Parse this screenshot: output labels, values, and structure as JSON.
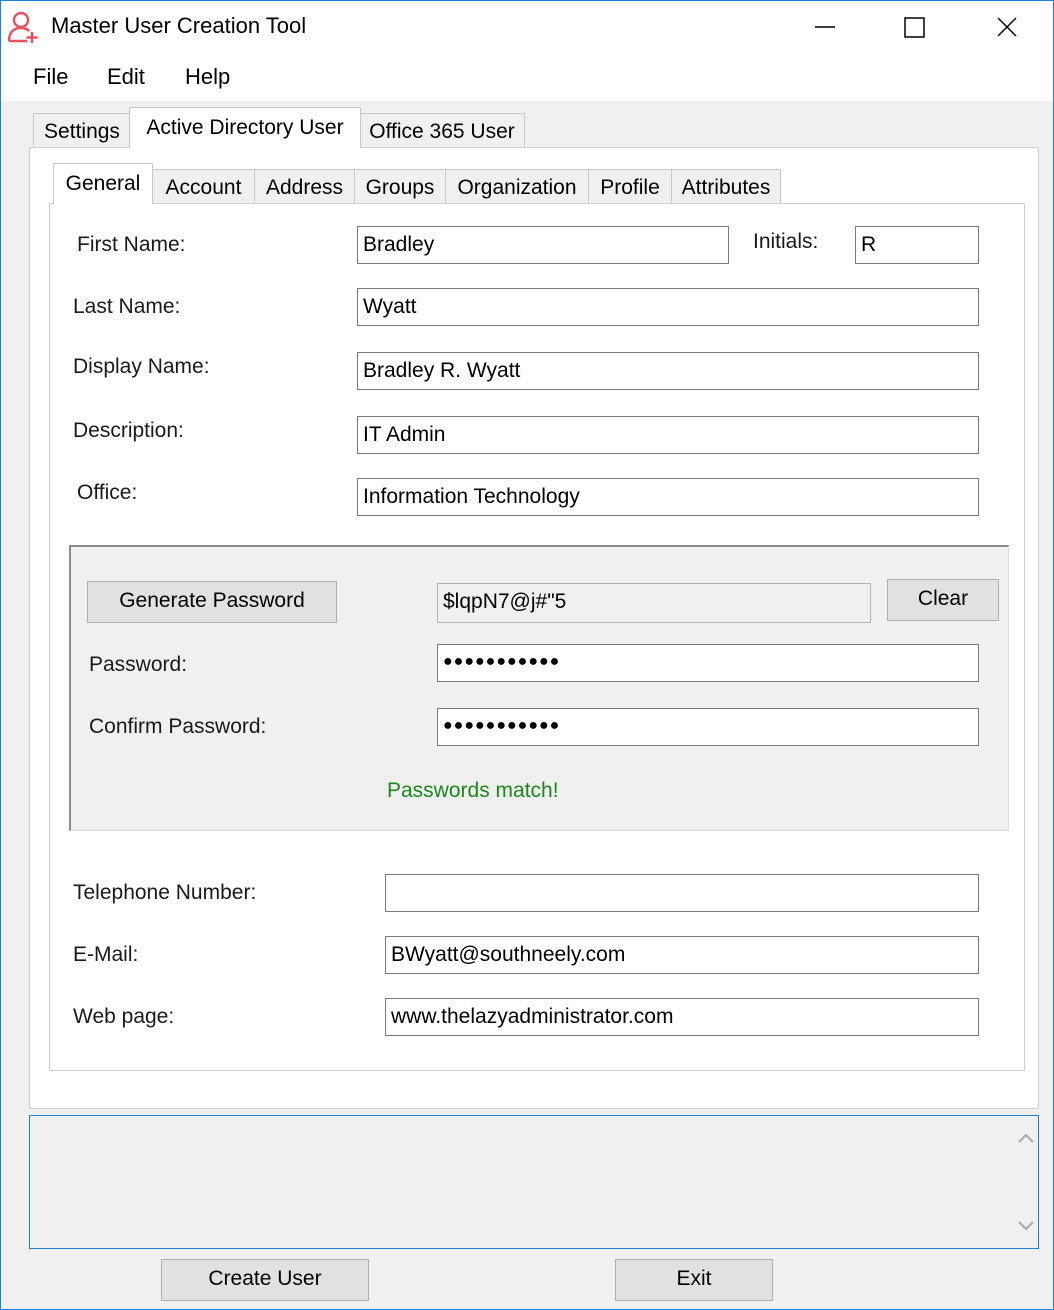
{
  "window": {
    "title": "Master User Creation Tool",
    "icon": "user-add-icon",
    "accent_color": "#1883d7",
    "icon_color": "#e8505b"
  },
  "menu": {
    "file": "File",
    "edit": "Edit",
    "help": "Help"
  },
  "top_tabs": {
    "settings": "Settings",
    "ad_user": "Active Directory User",
    "o365_user": "Office 365 User",
    "active": "Active Directory User"
  },
  "sub_tabs": {
    "general": "General",
    "account": "Account",
    "address": "Address",
    "groups": "Groups",
    "organization": "Organization",
    "profile": "Profile",
    "attributes": "Attributes",
    "active": "General"
  },
  "general": {
    "first_name_label": "First Name:",
    "first_name": "Bradley",
    "initials_label": "Initials:",
    "initials": "R",
    "last_name_label": "Last Name:",
    "last_name": "Wyatt",
    "display_name_label": "Display Name:",
    "display_name": "Bradley R. Wyatt",
    "description_label": "Description:",
    "description": "IT Admin",
    "office_label": "Office:",
    "office": "Information Technology"
  },
  "password": {
    "generate_button": "Generate Password",
    "generated": "$lqpN7@j#\"5",
    "clear_button": "Clear",
    "password_label": "Password:",
    "password_mask": "●●●●●●●●●●●",
    "confirm_label": "Confirm Password:",
    "confirm_mask": "●●●●●●●●●●●",
    "match_message": "Passwords match!",
    "match_color": "#1b8a1b"
  },
  "contact": {
    "telephone_label": "Telephone Number:",
    "telephone": "",
    "email_label": "E-Mail:",
    "email": "BWyatt@southneely.com",
    "webpage_label": "Web page:",
    "webpage": "www.thelazyadministrator.com"
  },
  "log": {
    "text": ""
  },
  "footer": {
    "create_button": "Create User",
    "exit_button": "Exit"
  }
}
